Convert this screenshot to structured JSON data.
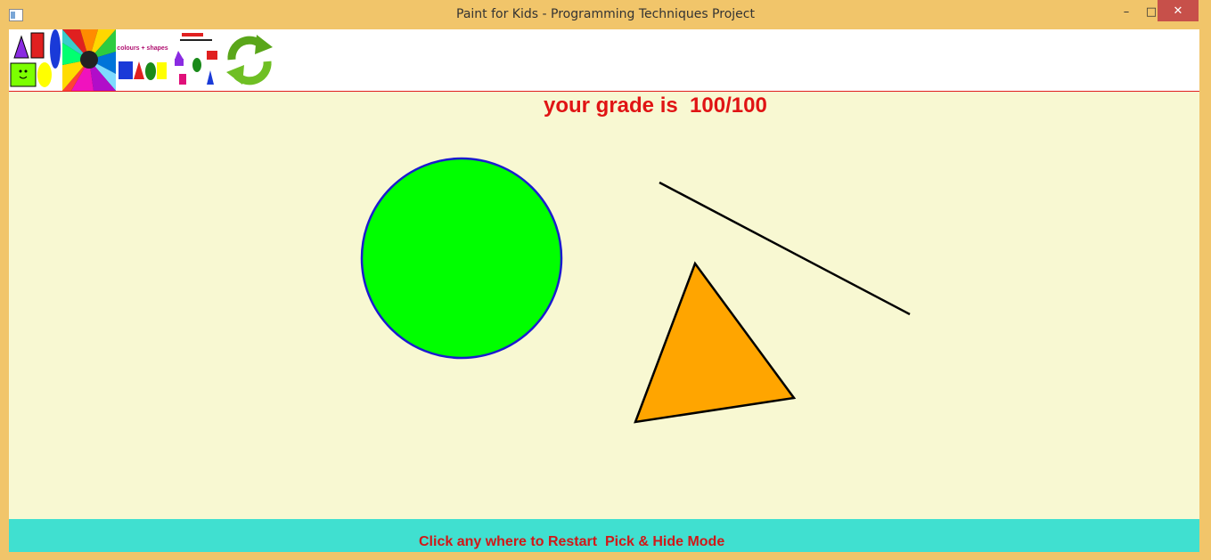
{
  "window": {
    "title": "Paint for Kids - Programming Techniques Project",
    "controls": {
      "minimize": "–",
      "maximize": "□",
      "close": "✕"
    },
    "frame_color": "#f1c56a"
  },
  "toolbar": {
    "items": [
      {
        "name": "shapes-mode-icon"
      },
      {
        "name": "colors-palette-icon"
      },
      {
        "name": "colours-and-shapes-icon"
      },
      {
        "name": "pick-and-hide-icon"
      },
      {
        "name": "restart-icon"
      }
    ]
  },
  "canvas": {
    "background": "#f8f8d2",
    "grade_label": "your grade is  100/100",
    "shapes": [
      {
        "type": "circle",
        "fill": "#00ff00",
        "stroke": "#1a1ad0"
      },
      {
        "type": "line",
        "stroke": "#000000"
      },
      {
        "type": "triangle",
        "fill": "#ffa500",
        "stroke": "#000000"
      }
    ]
  },
  "status_bar": {
    "message": "Click any where to Restart  Pick & Hide Mode",
    "background": "#40e0d0",
    "text_color": "#d01818"
  }
}
